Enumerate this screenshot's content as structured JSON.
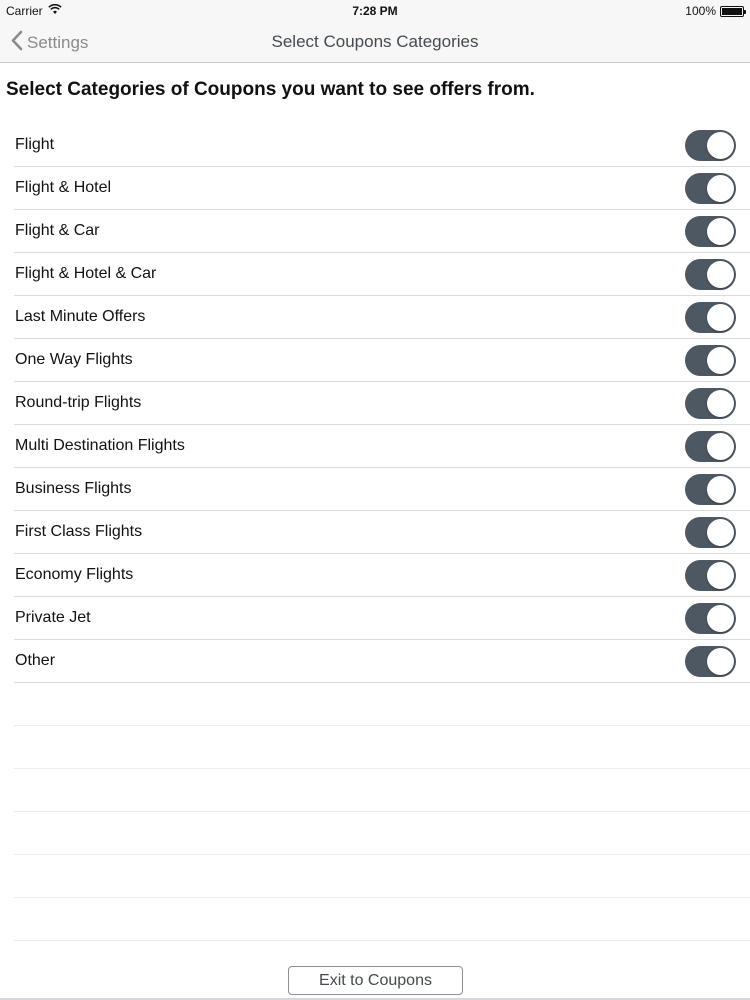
{
  "status_bar": {
    "carrier": "Carrier",
    "time": "7:28 PM",
    "battery_text": "100%",
    "battery_level": 1.0
  },
  "nav": {
    "back_label": "Settings",
    "title": "Select Coupons Categories"
  },
  "heading": "Select Categories of Coupons you want to see offers from.",
  "categories": [
    {
      "label": "Flight",
      "enabled": true
    },
    {
      "label": "Flight & Hotel",
      "enabled": true
    },
    {
      "label": "Flight & Car",
      "enabled": true
    },
    {
      "label": "Flight & Hotel & Car",
      "enabled": true
    },
    {
      "label": "Last Minute Offers",
      "enabled": true
    },
    {
      "label": "One Way Flights",
      "enabled": true
    },
    {
      "label": "Round-trip Flights",
      "enabled": true
    },
    {
      "label": "Multi Destination Flights",
      "enabled": true
    },
    {
      "label": "Business Flights",
      "enabled": true
    },
    {
      "label": "First Class Flights",
      "enabled": true
    },
    {
      "label": "Economy Flights",
      "enabled": true
    },
    {
      "label": "Private Jet",
      "enabled": true
    },
    {
      "label": "Other",
      "enabled": true
    }
  ],
  "exit_button_label": "Exit to Coupons",
  "colors": {
    "toggle_on": "#4e5863",
    "nav_text": "#444a51",
    "back_text": "#8a8a8f"
  }
}
